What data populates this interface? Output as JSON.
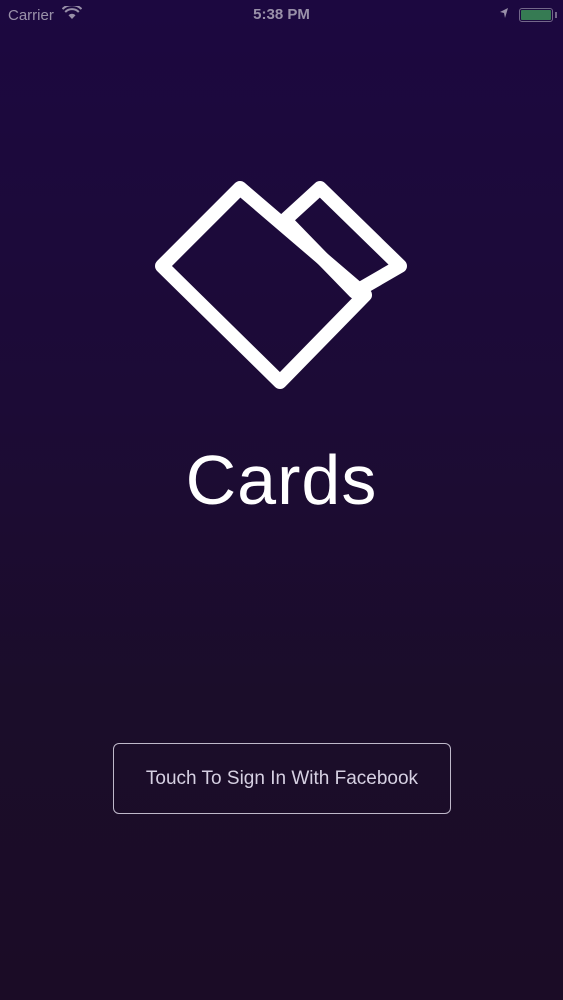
{
  "status_bar": {
    "carrier": "Carrier",
    "time": "5:38 PM",
    "battery_color": "#4cd964"
  },
  "logo": {
    "icon": "cards-heart-logo-icon",
    "color": "#ffffff"
  },
  "app": {
    "title": "Cards"
  },
  "login": {
    "button_label": "Touch To Sign In With Facebook"
  },
  "colors": {
    "background_top": "#1c0840",
    "background_bottom": "#1b0c26",
    "button_border": "#dcd7e6",
    "button_text": "#d6d0e2"
  }
}
